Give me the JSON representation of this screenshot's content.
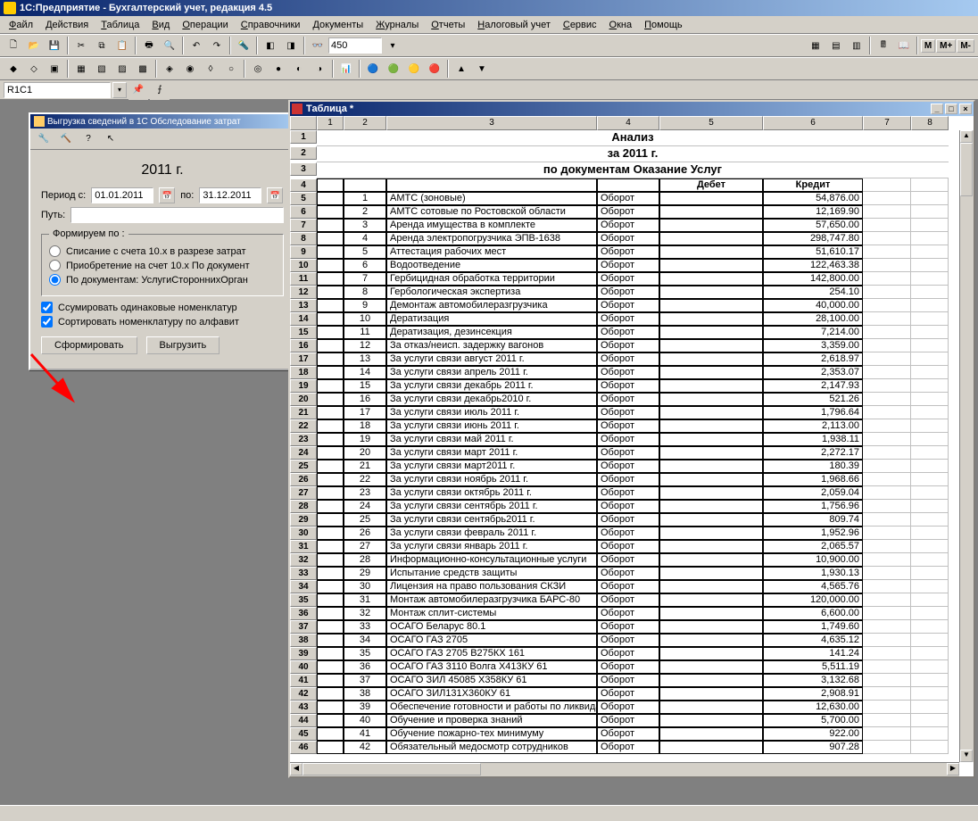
{
  "app_title": "1С:Предприятие - Бухгалтерский учет, редакция 4.5",
  "menubar": [
    "Файл",
    "Действия",
    "Таблица",
    "Вид",
    "Операции",
    "Справочники",
    "Документы",
    "Журналы",
    "Отчеты",
    "Налоговый учет",
    "Сервис",
    "Окна",
    "Помощь"
  ],
  "combo_value": "450",
  "cell_ref": "R1C1",
  "m_buttons": [
    "М",
    "М+",
    "М-"
  ],
  "dialog": {
    "title": "Выгрузка сведений в 1С Обследование затрат",
    "year_title": "2011 г.",
    "period_from_label": "Период с:",
    "period_from": "01.01.2011",
    "period_to_label": "по:",
    "period_to": "31.12.2011",
    "path_label": "Путь:",
    "path_value": "",
    "group_label": "Формируем по :",
    "radio1": "Списание с счета 10.х в разрезе затрат",
    "radio2": "Приобретение на счет 10.х По документ",
    "radio3": "По документам: УслугиСтороннихОрган",
    "check1": "Ссумировать одинаковые номенклатур",
    "check2": "Сортировать номенклатуру по алфавит",
    "btn_form": "Сформировать",
    "btn_export": "Выгрузить"
  },
  "sheet": {
    "title": "Таблица  *",
    "col_headers": [
      "1",
      "2",
      "3",
      "4",
      "5",
      "6",
      "7",
      "8"
    ],
    "t1": "Анализ",
    "t2": "за 2011 г.",
    "t3": "по документам Оказание Услуг",
    "h_debit": "Дебет",
    "h_credit": "Кредит",
    "rows": [
      {
        "r": 5,
        "n": 1,
        "name": "АМТС (зоновые)",
        "turn": "Оборот",
        "val": "54,876.00"
      },
      {
        "r": 6,
        "n": 2,
        "name": "АМТС сотовые по Ростовской области",
        "turn": "Оборот",
        "val": "12,169.90"
      },
      {
        "r": 7,
        "n": 3,
        "name": "Аренда имущества в комплекте",
        "turn": "Оборот",
        "val": "57,650.00"
      },
      {
        "r": 8,
        "n": 4,
        "name": "Аренда электропогрузчика ЭПВ-1638",
        "turn": "Оборот",
        "val": "298,747.80"
      },
      {
        "r": 9,
        "n": 5,
        "name": "Аттестация рабочих мест",
        "turn": "Оборот",
        "val": "51,610.17"
      },
      {
        "r": 10,
        "n": 6,
        "name": "Водоотведение",
        "turn": "Оборот",
        "val": "122,463.38"
      },
      {
        "r": 11,
        "n": 7,
        "name": "Гербицидная обработка территории",
        "turn": "Оборот",
        "val": "142,800.00"
      },
      {
        "r": 12,
        "n": 8,
        "name": "Гербологическая экспертиза",
        "turn": "Оборот",
        "val": "254.10"
      },
      {
        "r": 13,
        "n": 9,
        "name": "Демонтаж автомобилеразгрузчика",
        "turn": "Оборот",
        "val": "40,000.00"
      },
      {
        "r": 14,
        "n": 10,
        "name": "Дератизация",
        "turn": "Оборот",
        "val": "28,100.00"
      },
      {
        "r": 15,
        "n": 11,
        "name": "Дератизация, дезинсекция",
        "turn": "Оборот",
        "val": "7,214.00"
      },
      {
        "r": 16,
        "n": 12,
        "name": "За отказ/неисп. задержку  вагонов",
        "turn": "Оборот",
        "val": "3,359.00"
      },
      {
        "r": 17,
        "n": 13,
        "name": "За услуги связи август 2011 г.",
        "turn": "Оборот",
        "val": "2,618.97"
      },
      {
        "r": 18,
        "n": 14,
        "name": "За услуги связи апрель 2011 г.",
        "turn": "Оборот",
        "val": "2,353.07"
      },
      {
        "r": 19,
        "n": 15,
        "name": "За услуги связи декабрь 2011 г.",
        "turn": "Оборот",
        "val": "2,147.93"
      },
      {
        "r": 20,
        "n": 16,
        "name": "За услуги связи декабрь2010 г.",
        "turn": "Оборот",
        "val": "521.26"
      },
      {
        "r": 21,
        "n": 17,
        "name": "За услуги связи июль 2011 г.",
        "turn": "Оборот",
        "val": "1,796.64"
      },
      {
        "r": 22,
        "n": 18,
        "name": "За услуги связи июнь 2011 г.",
        "turn": "Оборот",
        "val": "2,113.00"
      },
      {
        "r": 23,
        "n": 19,
        "name": "За услуги связи май 2011 г.",
        "turn": "Оборот",
        "val": "1,938.11"
      },
      {
        "r": 24,
        "n": 20,
        "name": "За услуги связи март 2011 г.",
        "turn": "Оборот",
        "val": "2,272.17"
      },
      {
        "r": 25,
        "n": 21,
        "name": "За услуги связи март2011 г.",
        "turn": "Оборот",
        "val": "180.39"
      },
      {
        "r": 26,
        "n": 22,
        "name": "За услуги связи ноябрь 2011 г.",
        "turn": "Оборот",
        "val": "1,968.66"
      },
      {
        "r": 27,
        "n": 23,
        "name": "За услуги связи октябрь 2011 г.",
        "turn": "Оборот",
        "val": "2,059.04"
      },
      {
        "r": 28,
        "n": 24,
        "name": "За услуги связи сентябрь 2011 г.",
        "turn": "Оборот",
        "val": "1,756.96"
      },
      {
        "r": 29,
        "n": 25,
        "name": "За услуги связи сентябрь2011 г.",
        "turn": "Оборот",
        "val": "809.74"
      },
      {
        "r": 30,
        "n": 26,
        "name": "За услуги связи февраль 2011 г.",
        "turn": "Оборот",
        "val": "1,952.96"
      },
      {
        "r": 31,
        "n": 27,
        "name": "За услуги связи январь 2011 г.",
        "turn": "Оборот",
        "val": "2,065.57"
      },
      {
        "r": 32,
        "n": 28,
        "name": "Информационно-консультационные услуги",
        "turn": "Оборот",
        "val": "10,900.00"
      },
      {
        "r": 33,
        "n": 29,
        "name": "Испытание средств защиты",
        "turn": "Оборот",
        "val": "1,930.13"
      },
      {
        "r": 34,
        "n": 30,
        "name": "Лицензия на право пользования СКЗИ",
        "turn": "Оборот",
        "val": "4,565.76"
      },
      {
        "r": 35,
        "n": 31,
        "name": "Монтаж автомобилеразгрузчика БАРС-80",
        "turn": "Оборот",
        "val": "120,000.00"
      },
      {
        "r": 36,
        "n": 32,
        "name": "Монтаж сплит-системы",
        "turn": "Оборот",
        "val": "6,600.00"
      },
      {
        "r": 37,
        "n": 33,
        "name": "ОСАГО Беларус 80.1",
        "turn": "Оборот",
        "val": "1,749.60"
      },
      {
        "r": 38,
        "n": 34,
        "name": "ОСАГО ГАЗ 2705",
        "turn": "Оборот",
        "val": "4,635.12"
      },
      {
        "r": 39,
        "n": 35,
        "name": "ОСАГО ГАЗ 2705 В275КХ 161",
        "turn": "Оборот",
        "val": "141.24"
      },
      {
        "r": 40,
        "n": 36,
        "name": "ОСАГО ГАЗ 3110 Волга Х413КУ 61",
        "turn": "Оборот",
        "val": "5,511.19"
      },
      {
        "r": 41,
        "n": 37,
        "name": "ОСАГО ЗИЛ 45085 Х358КУ 61",
        "turn": "Оборот",
        "val": "3,132.68"
      },
      {
        "r": 42,
        "n": 38,
        "name": "ОСАГО ЗИЛ131Х360КУ 61",
        "turn": "Оборот",
        "val": "2,908.91"
      },
      {
        "r": 43,
        "n": 39,
        "name": "Обеспечение готовности и работы по ликвидации ЧС",
        "turn": "Оборот",
        "val": "12,630.00"
      },
      {
        "r": 44,
        "n": 40,
        "name": "Обучение и проверка знаний",
        "turn": "Оборот",
        "val": "5,700.00"
      },
      {
        "r": 45,
        "n": 41,
        "name": "Обучение пожарно-тех минимуму",
        "turn": "Оборот",
        "val": "922.00"
      },
      {
        "r": 46,
        "n": 42,
        "name": "Обязательный медосмотр сотрудников",
        "turn": "Оборот",
        "val": "907.28"
      }
    ]
  }
}
